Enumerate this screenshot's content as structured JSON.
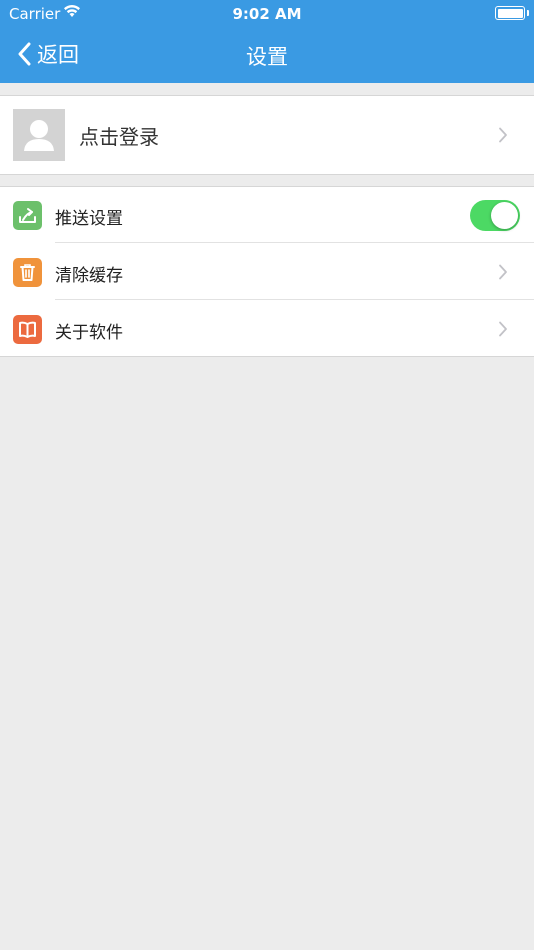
{
  "status_bar": {
    "carrier": "Carrier",
    "time": "9:02 AM"
  },
  "nav": {
    "back_label": "返回",
    "title": "设置"
  },
  "login": {
    "label": "点击登录"
  },
  "settings": {
    "items": [
      {
        "label": "推送设置",
        "icon": "push-upload-icon",
        "color": "#6cc06b",
        "control": "toggle",
        "enabled": true
      },
      {
        "label": "清除缓存",
        "icon": "trash-icon",
        "color": "#f0933b",
        "control": "chevron"
      },
      {
        "label": "关于软件",
        "icon": "book-icon",
        "color": "#ec6a3f",
        "control": "chevron"
      }
    ]
  },
  "colors": {
    "nav_bg": "#3a9ae3",
    "toggle_on": "#4cd964",
    "page_bg": "#ececec"
  }
}
